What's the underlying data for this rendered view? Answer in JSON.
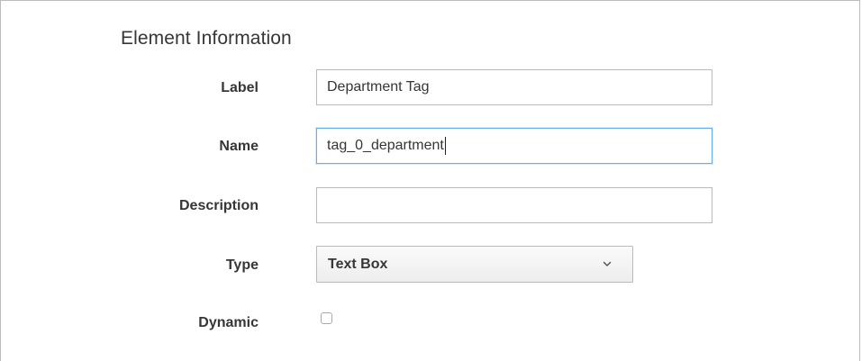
{
  "section": {
    "title": "Element Information"
  },
  "form": {
    "label": {
      "label": "Label",
      "value": "Department Tag",
      "placeholder": ""
    },
    "name": {
      "label": "Name",
      "value": "tag_0_department",
      "placeholder": ""
    },
    "description": {
      "label": "Description",
      "value": "",
      "placeholder": ""
    },
    "type": {
      "label": "Type",
      "selected": "Text Box"
    },
    "dynamic": {
      "label": "Dynamic",
      "checked": false
    }
  },
  "icons": {
    "select_chevron": "chevron-down-icon"
  },
  "colors": {
    "focus_border": "#66afe9",
    "field_border": "#bbbbbb",
    "text": "#363636"
  }
}
